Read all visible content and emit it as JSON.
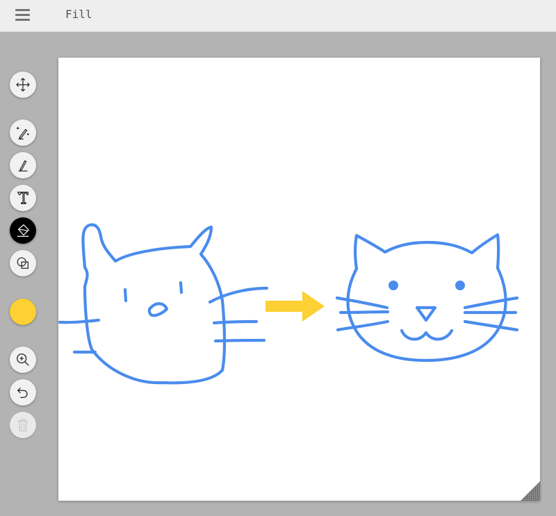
{
  "topbar": {
    "title": "Fill"
  },
  "toolbar": {
    "tools": [
      {
        "name": "move-tool",
        "icon": "move-arrows-icon"
      },
      {
        "name": "autodraw-tool",
        "icon": "sparkle-pencil-icon"
      },
      {
        "name": "draw-tool",
        "icon": "pencil-icon"
      },
      {
        "name": "type-tool",
        "icon": "text-icon"
      },
      {
        "name": "fill-tool",
        "icon": "paint-bucket-icon",
        "active": true
      },
      {
        "name": "shape-tool",
        "icon": "shapes-icon"
      },
      {
        "name": "zoom-tool",
        "icon": "zoom-in-icon"
      },
      {
        "name": "undo-tool",
        "icon": "undo-icon"
      },
      {
        "name": "delete-tool",
        "icon": "trash-icon",
        "disabled": true
      }
    ],
    "current_color": "#fdd033"
  },
  "colors": {
    "stroke": "#4a8ced",
    "arrow": "#fdd033",
    "canvas": "#ffffff",
    "background": "#b3b3b3"
  }
}
